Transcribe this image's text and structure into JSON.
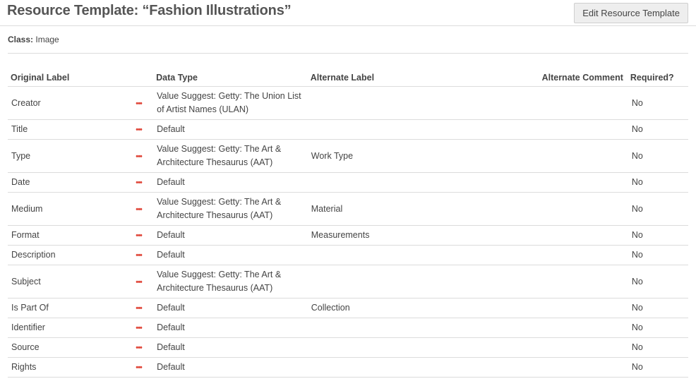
{
  "header": {
    "title": "Resource Template: “Fashion Illustrations”",
    "edit_button_label": "Edit Resource Template"
  },
  "class_info": {
    "label": "Class:",
    "value": "Image"
  },
  "table": {
    "columns": {
      "original_label": "Original Label",
      "data_type": "Data Type",
      "alternate_label": "Alternate Label",
      "alternate_comment": "Alternate Comment",
      "required": "Required?"
    },
    "rows": [
      {
        "label": "Creator",
        "data_type": "Value Suggest: Getty: The Union List of Artist Names (ULAN)",
        "alternate_label": "",
        "alternate_comment": "",
        "required": "No"
      },
      {
        "label": "Title",
        "data_type": "Default",
        "alternate_label": "",
        "alternate_comment": "",
        "required": "No"
      },
      {
        "label": "Type",
        "data_type": "Value Suggest: Getty: The Art & Architecture Thesaurus (AAT)",
        "alternate_label": "Work Type",
        "alternate_comment": "",
        "required": "No"
      },
      {
        "label": "Date",
        "data_type": "Default",
        "alternate_label": "",
        "alternate_comment": "",
        "required": "No"
      },
      {
        "label": "Medium",
        "data_type": "Value Suggest: Getty: The Art & Architecture Thesaurus (AAT)",
        "alternate_label": "Material",
        "alternate_comment": "",
        "required": "No"
      },
      {
        "label": "Format",
        "data_type": "Default",
        "alternate_label": "Measurements",
        "alternate_comment": "",
        "required": "No"
      },
      {
        "label": "Description",
        "data_type": "Default",
        "alternate_label": "",
        "alternate_comment": "",
        "required": "No"
      },
      {
        "label": "Subject",
        "data_type": "Value Suggest: Getty: The Art & Architecture Thesaurus (AAT)",
        "alternate_label": "",
        "alternate_comment": "",
        "required": "No"
      },
      {
        "label": "Is Part Of",
        "data_type": "Default",
        "alternate_label": "Collection",
        "alternate_comment": "",
        "required": "No"
      },
      {
        "label": "Identifier",
        "data_type": "Default",
        "alternate_label": "",
        "alternate_comment": "",
        "required": "No"
      },
      {
        "label": "Source",
        "data_type": "Default",
        "alternate_label": "",
        "alternate_comment": "",
        "required": "No"
      },
      {
        "label": "Rights",
        "data_type": "Default",
        "alternate_label": "",
        "alternate_comment": "",
        "required": "No"
      }
    ]
  },
  "icons": {
    "row_actions": "ellipsis-icon"
  },
  "colors": {
    "actions_accent": "#e0483b",
    "border": "#dcdcdc",
    "button_bg": "#eeeeee"
  }
}
